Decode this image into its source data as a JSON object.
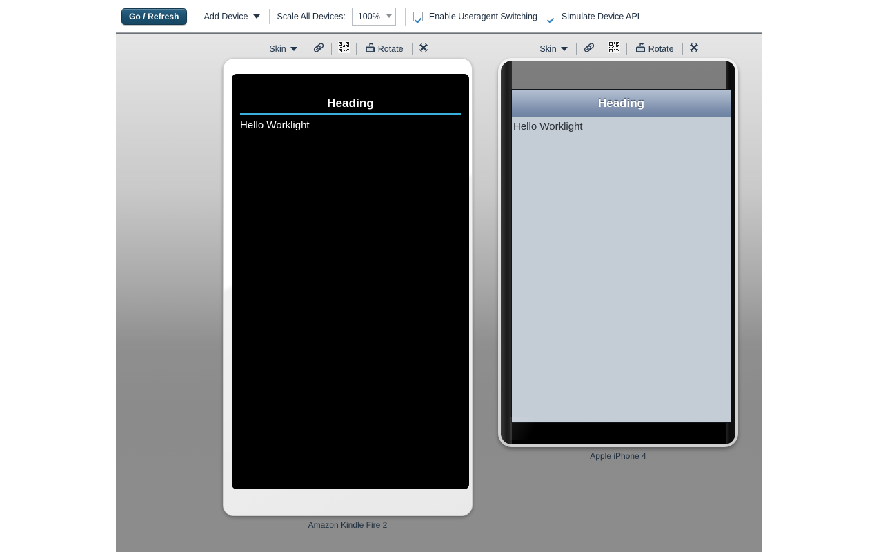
{
  "toolbar": {
    "go_refresh_label": "Go / Refresh",
    "add_device_label": "Add Device",
    "scale_all_label": "Scale All Devices:",
    "scale_value": "100%",
    "scale_options": [
      "100%"
    ],
    "useragent_switching_label": "Enable Useragent Switching",
    "useragent_switching_checked": true,
    "simulate_device_api_label": "Simulate Device API",
    "simulate_device_api_checked": true,
    "icons": {
      "add_device_caret": "chevron-down-icon",
      "scale_caret": "chevron-down-icon"
    },
    "accent_color": "#1b4f6e",
    "checkbox_check_color": "#2e7fbf"
  },
  "devices": [
    {
      "caption": "Amazon Kindle Fire 2",
      "toolbar": {
        "skin_label": "Skin",
        "skin_caret": "chevron-down-icon",
        "tag_icon": "tag-icon",
        "qr_icon": "qr-code-icon",
        "rotate_icon": "rotate-device-icon",
        "rotate_label": "Rotate",
        "close_icon": "close-icon"
      },
      "screen": {
        "heading": "Heading",
        "body_text": "Hello Worklight",
        "background_color": "#000000",
        "heading_color": "#ffffff",
        "rule_color": "#3aafdd",
        "body_color": "#ffffff"
      }
    },
    {
      "caption": "Apple iPhone 4",
      "toolbar": {
        "skin_label": "Skin",
        "skin_caret": "chevron-down-icon",
        "tag_icon": "tag-icon",
        "qr_icon": "qr-code-icon",
        "rotate_icon": "rotate-device-icon",
        "rotate_label": "Rotate",
        "close_icon": "close-icon"
      },
      "screen": {
        "heading": "Heading",
        "body_text": "Hello Worklight",
        "background_color": "#c4ccd6",
        "header_gradient_top": "#b4c0d2",
        "header_gradient_bottom": "#6d81a2",
        "heading_color": "#ffffff",
        "body_color": "#2b2f34"
      }
    }
  ]
}
